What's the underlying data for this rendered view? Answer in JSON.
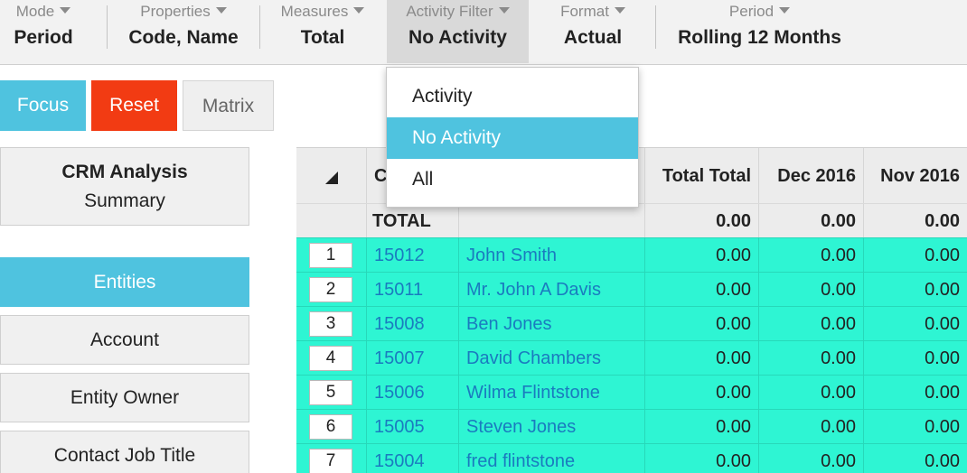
{
  "toolbar": {
    "items": [
      {
        "label": "Mode",
        "value": "Period"
      },
      {
        "label": "Properties",
        "value": "Code, Name"
      },
      {
        "label": "Measures",
        "value": "Total"
      },
      {
        "label": "Activity Filter",
        "value": "No Activity"
      },
      {
        "label": "Format",
        "value": "Actual"
      },
      {
        "label": "Period",
        "value": "Rolling 12 Months"
      }
    ]
  },
  "buttons": {
    "focus": "Focus",
    "reset": "Reset",
    "matrix": "Matrix"
  },
  "colors": {
    "accent": "#4fc3df",
    "reset": "#f23b13",
    "row_highlight": "#2ef5d3",
    "link": "#1a7bbf"
  },
  "sidebar": {
    "title": "CRM Analysis",
    "subtitle": "Summary",
    "items": [
      {
        "label": "Entities",
        "selected": true
      },
      {
        "label": "Account",
        "selected": false
      },
      {
        "label": "Entity Owner",
        "selected": false
      },
      {
        "label": "Contact Job Title",
        "selected": false
      }
    ]
  },
  "grid": {
    "columns": [
      "C",
      "",
      "Total Total",
      "Dec 2016",
      "Nov 2016"
    ],
    "total_row": {
      "label": "TOTAL",
      "values": [
        "0.00",
        "0.00",
        "0.00"
      ]
    },
    "rows": [
      {
        "num": "1",
        "code": "15012",
        "name": "John Smith",
        "values": [
          "0.00",
          "0.00",
          "0.00"
        ]
      },
      {
        "num": "2",
        "code": "15011",
        "name": "Mr. John A Davis",
        "values": [
          "0.00",
          "0.00",
          "0.00"
        ]
      },
      {
        "num": "3",
        "code": "15008",
        "name": "Ben Jones",
        "values": [
          "0.00",
          "0.00",
          "0.00"
        ]
      },
      {
        "num": "4",
        "code": "15007",
        "name": "David Chambers",
        "values": [
          "0.00",
          "0.00",
          "0.00"
        ]
      },
      {
        "num": "5",
        "code": "15006",
        "name": "Wilma Flintstone",
        "values": [
          "0.00",
          "0.00",
          "0.00"
        ]
      },
      {
        "num": "6",
        "code": "15005",
        "name": "Steven Jones",
        "values": [
          "0.00",
          "0.00",
          "0.00"
        ]
      },
      {
        "num": "7",
        "code": "15004",
        "name": "fred flintstone",
        "values": [
          "0.00",
          "0.00",
          "0.00"
        ]
      }
    ]
  },
  "dropdown": {
    "options": [
      {
        "label": "Activity",
        "selected": false
      },
      {
        "label": "No Activity",
        "selected": true
      },
      {
        "label": "All",
        "selected": false
      }
    ]
  }
}
